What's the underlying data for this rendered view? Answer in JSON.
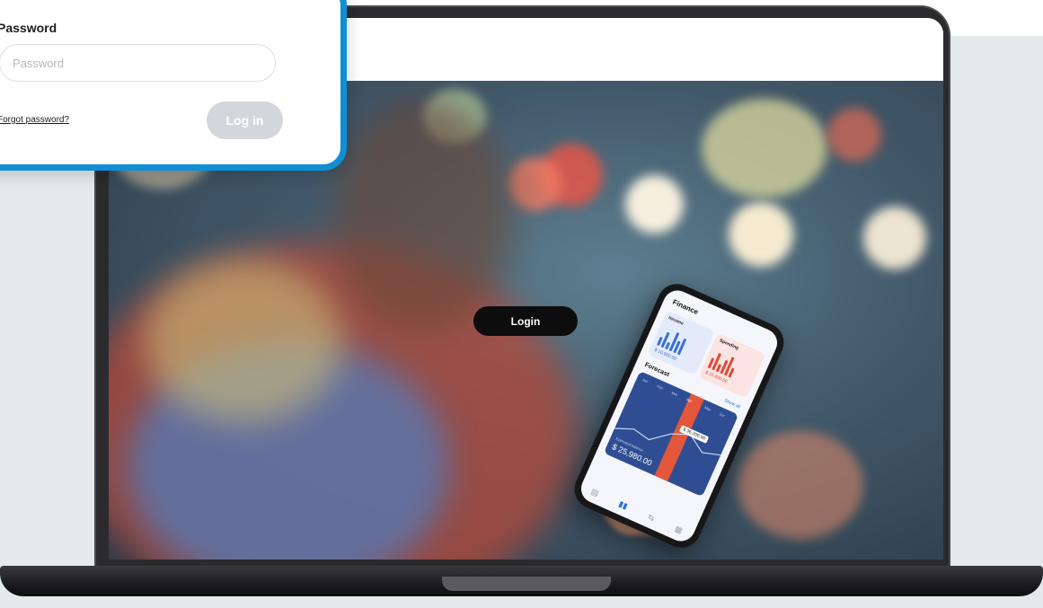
{
  "login_popup": {
    "password_label": "Password",
    "password_placeholder": "Password",
    "password_value": "",
    "forgot_password": "Forgot password?",
    "login_button": "Log in",
    "accent_color": "#0f8fd6"
  },
  "hero": {
    "login_button": "Login"
  },
  "phone_app": {
    "title": "Finance",
    "income_label": "Income",
    "income_amount": "$ 10,680.00",
    "spending_label": "Spending",
    "spending_amount": "$ 10,400.00",
    "forecast_label": "Forecast",
    "show_all": "Show all",
    "months": [
      "Jan",
      "Feb",
      "Mar",
      "Apr",
      "May",
      "Jun"
    ],
    "tooltip": "$ 36,200.00",
    "balance_label": "Estimated balance",
    "balance": "$ 25,980.00",
    "nav_icons": [
      "document-icon",
      "chart-icon",
      "transfer-icon",
      "grid-icon"
    ]
  }
}
